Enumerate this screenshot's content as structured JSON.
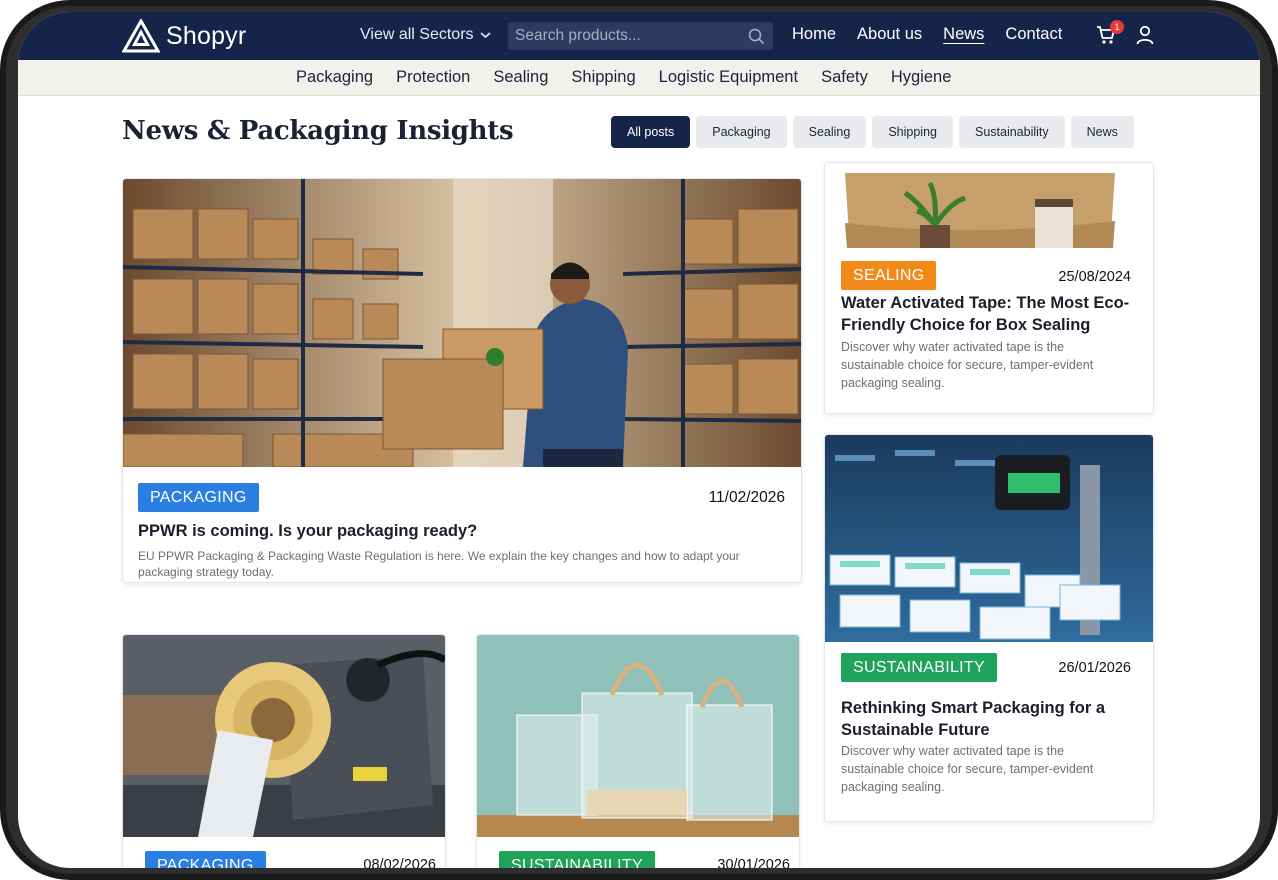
{
  "brand": {
    "name": "Shopyr",
    "dark": "#15254a"
  },
  "header": {
    "sectors_label": "View all Sectors",
    "search_placeholder": "Search products...",
    "nav": [
      {
        "label": "Home"
      },
      {
        "label": "About us"
      },
      {
        "label": "News",
        "active": true
      },
      {
        "label": "Contact"
      }
    ],
    "cart_count": "1"
  },
  "categories": [
    "Packaging",
    "Protection",
    "Sealing",
    "Shipping",
    "Logistic Equipment",
    "Safety",
    "Hygiene"
  ],
  "page": {
    "title": "News & Packaging Insights"
  },
  "filters": [
    "All posts",
    "Packaging",
    "Sealing",
    "Shipping",
    "Sustainability",
    "News"
  ],
  "tag_colors": {
    "packaging": "#2a7de1",
    "sealing": "#f28a1a",
    "sustainability": "#1fa35a"
  },
  "posts": {
    "featured": {
      "tag": "PACKAGING",
      "date": "11/02/2026",
      "title": "PPWR is coming. Is your packaging ready?",
      "desc": "EU PPWR Packaging & Packaging Waste Regulation is here. We explain the key changes and how to adapt your packaging strategy today."
    },
    "side1": {
      "tag": "SEALING",
      "date": "25/08/2024",
      "title": "Water Activated Tape: The Most Eco-Friendly Choice for Box Sealing",
      "desc": "Discover why water activated tape is the sustainable choice for secure, tamper-evident packaging sealing."
    },
    "side2": {
      "tag": "SUSTAINABILITY",
      "date": "26/01/2026",
      "title": "Rethinking Smart Packaging for a Sustainable Future",
      "desc": "Discover why water activated tape is the sustainable choice for secure, tamper-evident packaging sealing."
    },
    "bottom1": {
      "tag": "PACKAGING",
      "date": "08/02/2026"
    },
    "bottom2": {
      "tag": "SUSTAINABILITY",
      "date": "30/01/2026"
    }
  }
}
